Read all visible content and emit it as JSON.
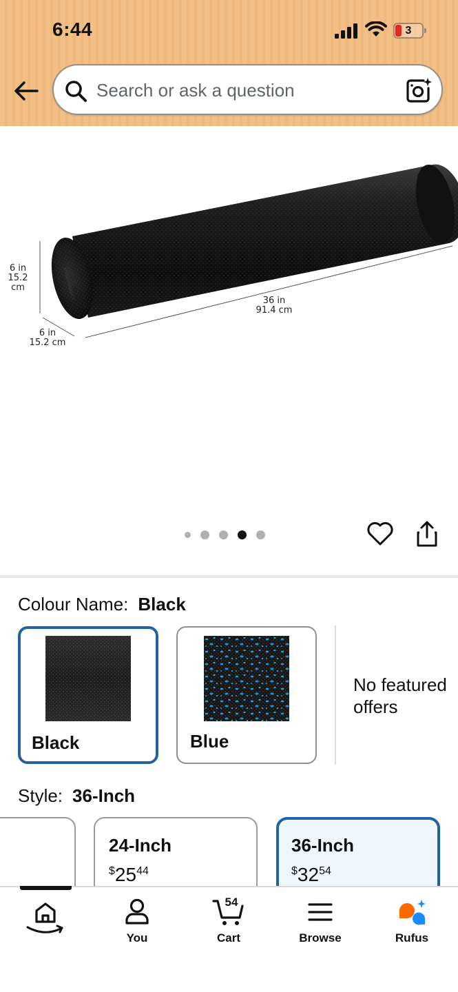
{
  "status_bar": {
    "time": "6:44",
    "battery": "3",
    "signal_icon": "cellular-signal-icon",
    "wifi_icon": "wifi-icon"
  },
  "header": {
    "back_icon": "arrow-left-icon",
    "search_placeholder": "Search or ask a question",
    "camera_icon": "camera-search-icon"
  },
  "gallery": {
    "dimensions": {
      "height_in": "6 in",
      "height_cm": "15.2 cm",
      "depth_in": "6 in",
      "depth_cm": "15.2 cm",
      "length_in": "36 in",
      "length_cm": "91.4 cm"
    },
    "image_count": 5,
    "active_index": 3
  },
  "colour": {
    "label": "Colour Name:",
    "selected": "Black",
    "options": [
      {
        "label": "Black",
        "selected": true
      },
      {
        "label": "Blue",
        "selected": false
      }
    ],
    "no_offers": "No featured offers"
  },
  "style": {
    "label": "Style:",
    "selected": "36-Inch",
    "options": [
      {
        "name": "24-Inch",
        "price_symbol": "$",
        "price_whole": "25",
        "price_fraction": "44",
        "selected": false
      },
      {
        "name": "36-Inch",
        "price_symbol": "$",
        "price_whole": "32",
        "price_fraction": "54",
        "selected": true
      }
    ]
  },
  "bottom_nav": {
    "items": [
      {
        "label": "",
        "icon": "home-icon",
        "active": true
      },
      {
        "label": "You",
        "icon": "person-icon"
      },
      {
        "label": "Cart",
        "icon": "cart-icon",
        "count": "54"
      },
      {
        "label": "Browse",
        "icon": "menu-icon"
      },
      {
        "label": "Rufus",
        "icon": "rufus-chat-icon"
      }
    ]
  },
  "colors": {
    "header_bg": "#f2bf86",
    "selected_border": "#2162a1",
    "selected_card_bg": "#edf7fc",
    "rufus_orange": "#ff6a00",
    "rufus_blue": "#1a8cff"
  }
}
